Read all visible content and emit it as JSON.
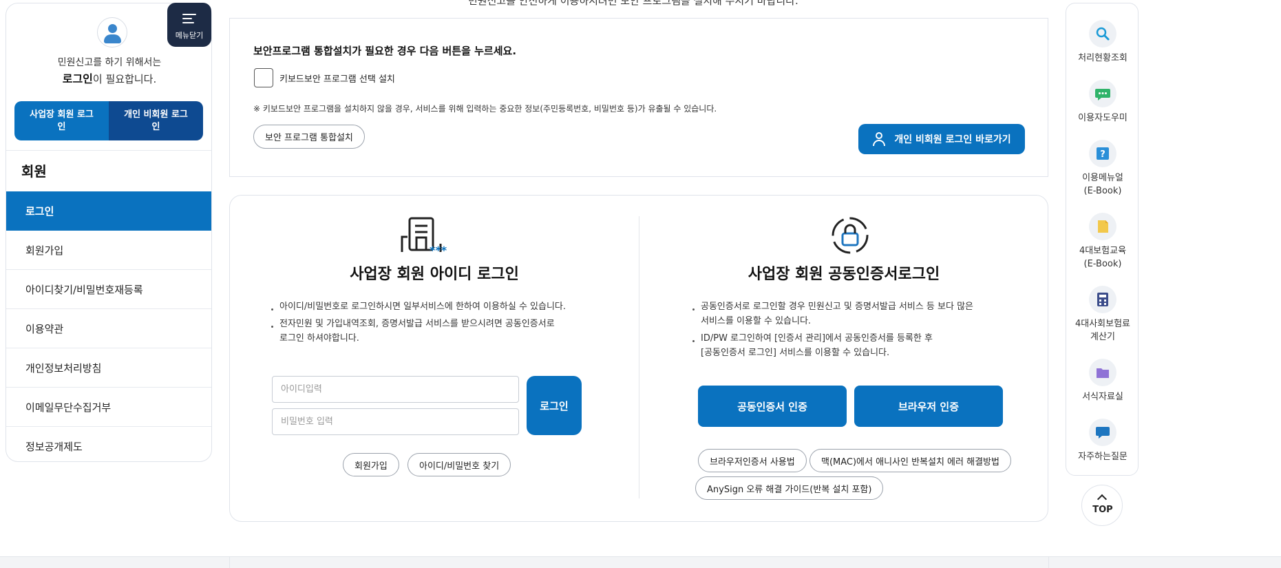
{
  "sidebar": {
    "message_line1": "민원신고를 하기 위해서는",
    "message_strong": "로그인",
    "message_rest": "이 필요합니다.",
    "biz_login_label": "사업장 회원 로그인",
    "personal_login_label": "개인 비회원 로그인",
    "heading": "회원",
    "menu_items": [
      {
        "label": "로그인",
        "active": true
      },
      {
        "label": "회원가입"
      },
      {
        "label": "아이디찾기/비밀번호재등록"
      },
      {
        "label": "이용약관"
      },
      {
        "label": "개인정보처리방침"
      },
      {
        "label": "이메일무단수집거부"
      },
      {
        "label": "정보공개제도"
      }
    ]
  },
  "menu_toggle": {
    "label": "메뉴닫기"
  },
  "top_cut_text": "민원신고를 안전하게 이용하시려면 보안 프로그램을 설치해 주시기 바랍니다.",
  "security": {
    "title": "보안프로그램 통합설치가 필요한 경우 다음 버튼을 누르세요.",
    "checkbox_label": "키보드보안 프로그램 선택 설치",
    "note": "※ 키보드보안 프로그램을 설치하지 않을 경우, 서비스를 위해 입력하는 중요한 정보(주민등록번호, 비밀번호 등)가 유출될 수 있습니다.",
    "install_button": "보안 프로그램 통합설치",
    "nonmember_button": "개인 비회원 로그인 바로가기"
  },
  "id_login": {
    "title": "사업장 회원 아이디 로그인",
    "bullets": [
      [
        "아이디/비밀번호로 로그인하시면 일부서비스에 한하여 이용하실 수 있습니다."
      ],
      [
        "전자민원 및 가입내역조회, 증명서발급 서비스를 받으시려면 공동인증서로",
        "로그인 하셔야합니다."
      ]
    ],
    "id_placeholder": "아이디입력",
    "pw_placeholder": "비밀번호 입력",
    "login_button": "로그인",
    "signup_button": "회원가입",
    "find_button": "아이디/비밀번호 찾기"
  },
  "cert_login": {
    "title": "사업장 회원 공동인증서로그인",
    "bullets": [
      [
        "공동인증서로 로그인할 경우 민원신고 및 증명서발급 서비스 등 보다 많은",
        "서비스를 이용할 수 있습니다."
      ],
      [
        "ID/PW 로그인하여 [인증서 관리]에서 공동인증서를 등록한 후",
        "[공동인증서 로그인] 서비스를 이용할 수 있습니다."
      ]
    ],
    "cert_button": "공동인증서 인증",
    "browser_button": "브라우저 인증",
    "help_links": [
      "브라우저인증서 사용법",
      "맥(MAC)에서 애니사인 반복설치 에러 해결방법",
      "AnySign 오류 해결 가이드(반복 설치 포함)"
    ]
  },
  "quick_menu": [
    {
      "label1": "처리현황조회",
      "label2": "",
      "icon": "search-icon",
      "color": "#1a9ad6"
    },
    {
      "label1": "이용자도우미",
      "label2": "",
      "icon": "chat-icon",
      "color": "#2fb36a"
    },
    {
      "label1": "이용메뉴얼",
      "label2": "(E-Book)",
      "icon": "question-icon",
      "color": "#2a8fd8"
    },
    {
      "label1": "4대보험교육",
      "label2": "(E-Book)",
      "icon": "book-icon",
      "color": "#f2c84b"
    },
    {
      "label1": "4대사회보험료",
      "label2": "계산기",
      "icon": "calculator-icon",
      "color": "#3b4c8a"
    },
    {
      "label1": "서식자료실",
      "label2": "",
      "icon": "folder-icon",
      "color": "#8f72d6"
    },
    {
      "label1": "자주하는질문",
      "label2": "",
      "icon": "faq-icon",
      "color": "#1e76c0"
    }
  ],
  "top_button": "TOP",
  "colors": {
    "primary": "#0a72bf",
    "dark_primary": "#0e4a91",
    "menu_toggle": "#1d2b45"
  }
}
